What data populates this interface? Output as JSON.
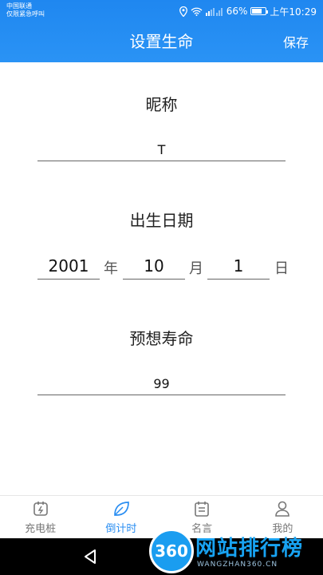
{
  "status_bar": {
    "carrier_line1": "中国联通",
    "carrier_line2": "仅限紧急呼叫",
    "battery": "66%",
    "time": "上午10:29"
  },
  "app_bar": {
    "title": "设置生命",
    "save_label": "保存"
  },
  "form": {
    "nickname": {
      "label": "昵称",
      "value": "T"
    },
    "birthday": {
      "label": "出生日期",
      "year": "2001",
      "year_unit": "年",
      "month": "10",
      "month_unit": "月",
      "day": "1",
      "day_unit": "日"
    },
    "life_expectancy": {
      "label": "预想寿命",
      "value": "99"
    }
  },
  "bottom_nav": {
    "items": [
      {
        "label": "充电桩",
        "icon": "charging-plug-icon",
        "active": false
      },
      {
        "label": "倒计时",
        "icon": "leaf-icon",
        "active": true
      },
      {
        "label": "名言",
        "icon": "calendar-note-icon",
        "active": false
      },
      {
        "label": "我的",
        "icon": "person-icon",
        "active": false
      }
    ]
  },
  "watermark": {
    "badge": "360",
    "text": "网站排行榜",
    "sub": "WANGZHAN360.CN"
  },
  "colors": {
    "header": "#2a93f5",
    "accent": "#2a8ef2",
    "underline": "#666666"
  }
}
